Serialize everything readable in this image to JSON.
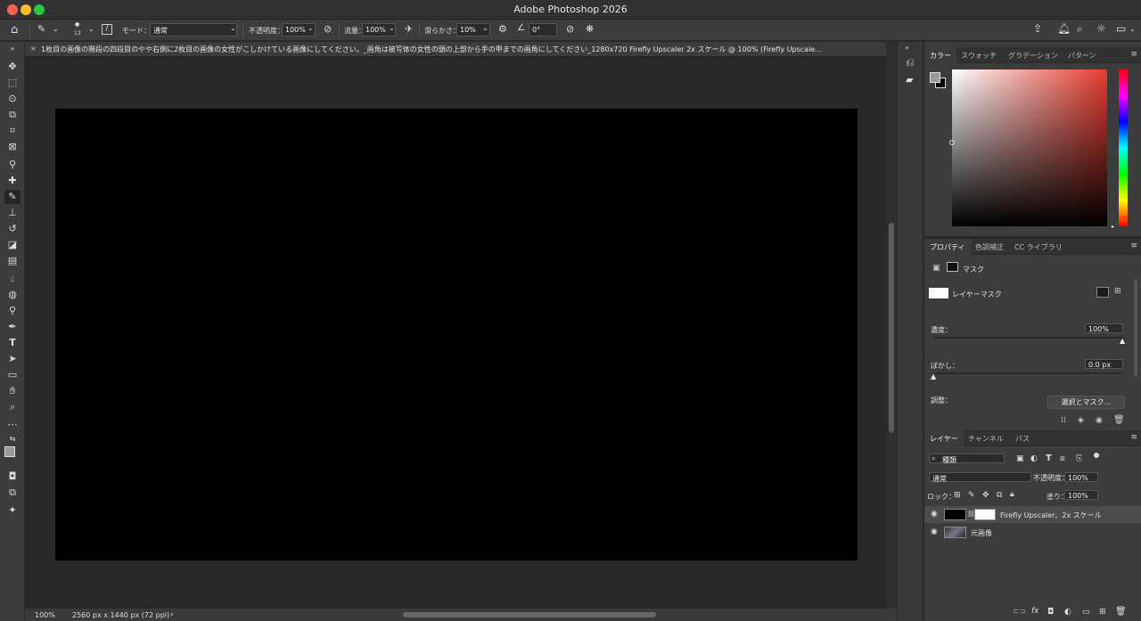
{
  "window": {
    "title": "Adobe Photoshop 2026"
  },
  "optionsBar": {
    "brush_size": "13",
    "mode_label": "モード：",
    "mode_value": "通常",
    "opacity_label": "不透明度：",
    "opacity_value": "100%",
    "flow_label": "流量：",
    "flow_value": "100%",
    "smoothing_label": "滑らかさ：",
    "smoothing_value": "10%",
    "angle_value": "0°"
  },
  "document": {
    "close": "×",
    "tab_title": "1枚目の画像の階段の四段目のやや右側に2枚目の画像の女性がこしかけている画像にしてください。_画角は被写体の女性の頭の上部から手の甲までの画角にしてください_1280x720 Firefly Upscaler 2x スケール @ 100% (Firefly Upscale...",
    "expand": "»"
  },
  "status": {
    "zoom": "100%",
    "info": "2560 px x 1440 px (72 ppi)",
    "arrow": "›"
  },
  "colorPanel": {
    "tabs": [
      "カラー",
      "スウォッチ",
      "グラデーション",
      "パターン"
    ]
  },
  "propertiesPanel": {
    "tabs": [
      "プロパティ",
      "色調補正",
      "CC ライブラリ"
    ],
    "mask_label": "マスク",
    "layer_mask_label": "レイヤーマスク",
    "density_label": "濃度：",
    "density_value": "100%",
    "density_fraction": 1.0,
    "feather_label": "ぼかし：",
    "feather_value": "0.0 px",
    "feather_fraction": 0.0,
    "adjust_label": "調整：",
    "select_mask_button": "選択とマスク..."
  },
  "layersPanel": {
    "tabs": [
      "レイヤー",
      "チャンネル",
      "パス"
    ],
    "filter_value": "種類",
    "blend_value": "通常",
    "opacity_label": "不透明度：",
    "opacity_value": "100%",
    "lock_label": "ロック：",
    "fill_label": "塗り：",
    "fill_value": "100%",
    "layers": [
      {
        "name": "Firefly Upscaler、2x スケール"
      },
      {
        "name": "元画像"
      }
    ]
  },
  "colors": {
    "accent": "#e63b2e",
    "canvas": "#000000"
  }
}
